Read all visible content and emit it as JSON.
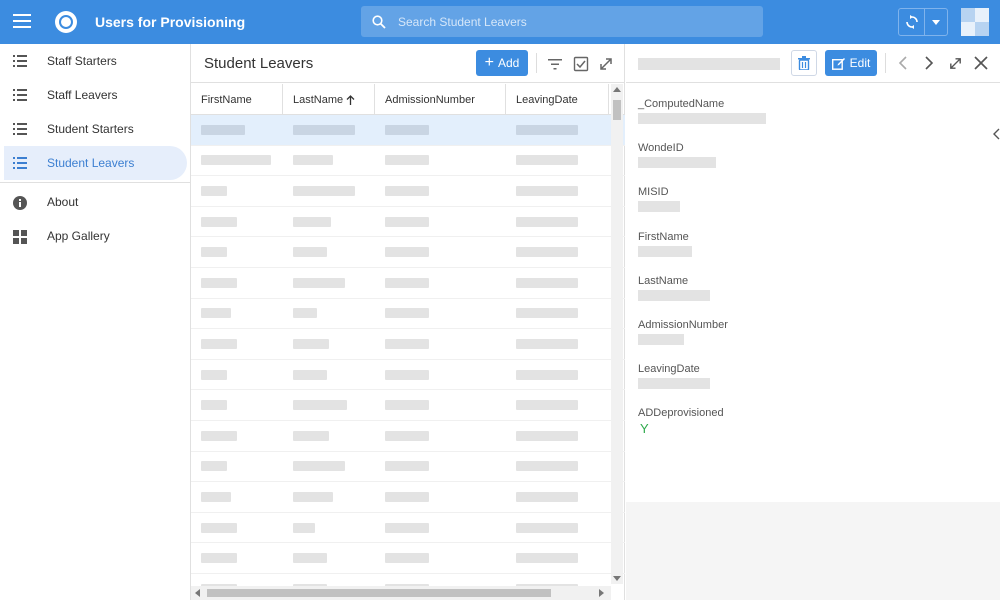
{
  "app": {
    "title": "Users for Provisioning",
    "search_placeholder": "Search Student Leavers",
    "accent_color": "#3c8ce0"
  },
  "sidebar": {
    "items": [
      {
        "label": "Staff Starters",
        "icon": "list-icon"
      },
      {
        "label": "Staff Leavers",
        "icon": "list-icon"
      },
      {
        "label": "Student Starters",
        "icon": "list-icon"
      },
      {
        "label": "Student Leavers",
        "icon": "list-icon",
        "active": true
      }
    ],
    "extra": [
      {
        "label": "About",
        "icon": "info-icon"
      },
      {
        "label": "App Gallery",
        "icon": "grid-icon"
      }
    ]
  },
  "list": {
    "title": "Student Leavers",
    "add_label": "Add",
    "columns": [
      "FirstName",
      "LastName",
      "AdmissionNumber",
      "LeavingDate"
    ],
    "sorted_column": "LastName",
    "sort_direction": "ascending",
    "row_count_visible": 16,
    "selected_row": 0
  },
  "detail": {
    "edit_label": "Edit",
    "fields": [
      {
        "label": "_ComputedName",
        "value": null
      },
      {
        "label": "WondeID",
        "value": null
      },
      {
        "label": "MISID",
        "value": null
      },
      {
        "label": "FirstName",
        "value": null
      },
      {
        "label": "LastName",
        "value": null
      },
      {
        "label": "AdmissionNumber",
        "value": null
      },
      {
        "label": "LeavingDate",
        "value": null
      },
      {
        "label": "ADDeprovisioned",
        "value": "Y"
      }
    ]
  }
}
